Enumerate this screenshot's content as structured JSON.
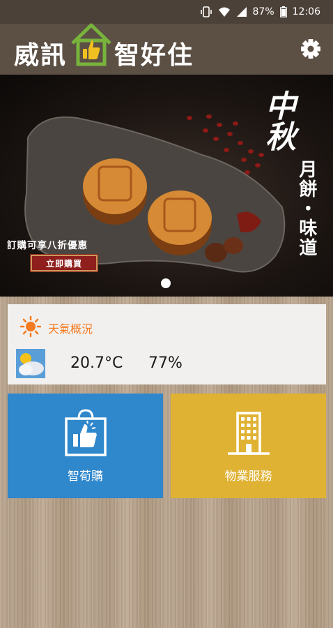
{
  "status_bar": {
    "battery": "87%",
    "time": "12:06"
  },
  "header": {
    "logo_left": "威訊",
    "logo_right": "智好住"
  },
  "banner": {
    "title": "中秋",
    "subtitle": "月餅・味道",
    "promo_text": "訂購可享八折優惠",
    "buy_label": "立即購買"
  },
  "weather": {
    "title": "天氣概況",
    "temperature": "20.7°C",
    "humidity": "77%"
  },
  "tiles": [
    {
      "label": "智荀購",
      "color": "#2f87cc",
      "icon": "shopping-bag-thumbs-up-icon"
    },
    {
      "label": "物業服務",
      "color": "#e0b233",
      "icon": "building-icon"
    }
  ]
}
